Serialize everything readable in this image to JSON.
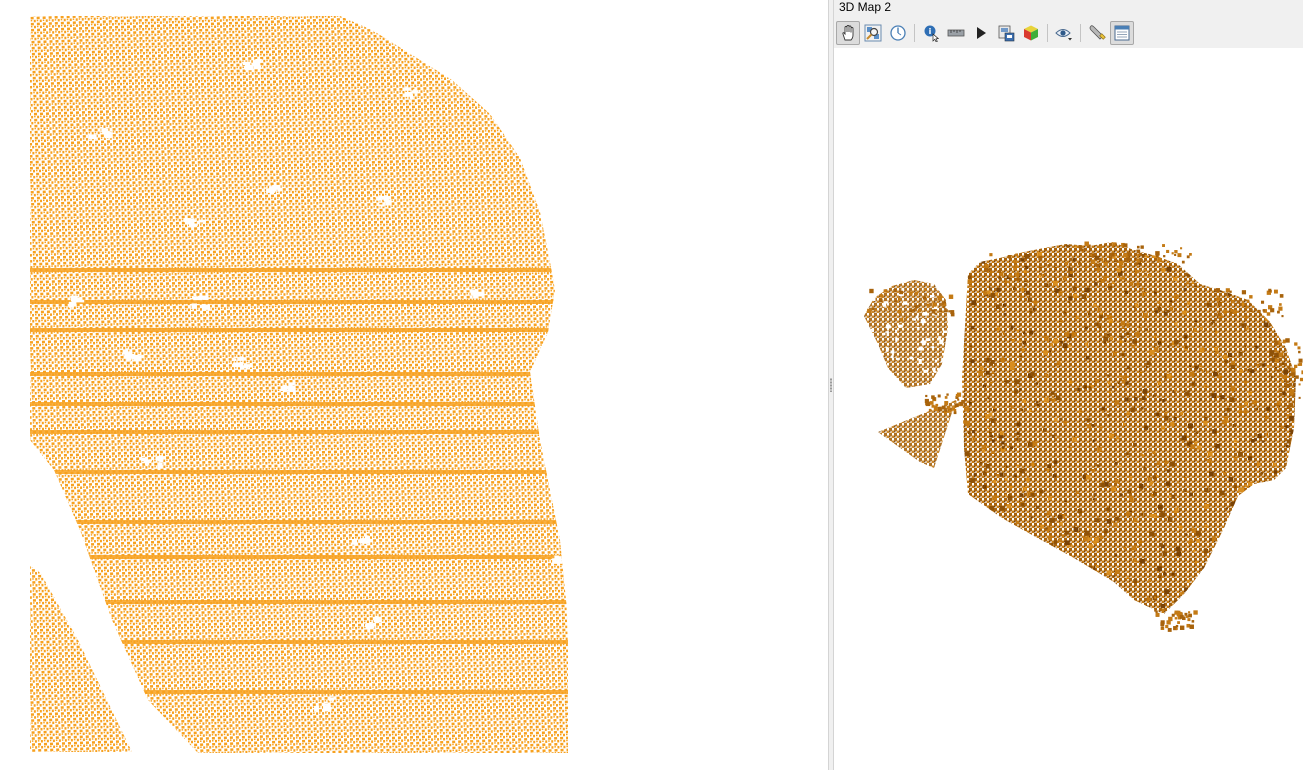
{
  "dock": {
    "title": "3D Map 2"
  },
  "toolbar": {
    "buttons": [
      {
        "name": "camera-control-button",
        "icon": "hand-pan-icon",
        "active": true
      },
      {
        "name": "zoom-full-button",
        "icon": "zoom-full-icon",
        "active": false
      },
      {
        "name": "reset-rotation-button",
        "icon": "compass-icon",
        "active": false
      },
      {
        "name": "identify-button",
        "icon": "identify-icon",
        "active": false
      },
      {
        "name": "measure-button",
        "icon": "measure-ruler-icon",
        "active": false
      },
      {
        "name": "animation-button",
        "icon": "play-icon",
        "active": false
      },
      {
        "name": "save-image-button",
        "icon": "save-image-icon",
        "active": false
      },
      {
        "name": "export-scene-button",
        "icon": "export-3d-icon",
        "active": false
      },
      {
        "name": "camera-view-button",
        "icon": "eye-icon",
        "active": false
      },
      {
        "name": "configure-button",
        "icon": "wrench-icon",
        "active": false
      },
      {
        "name": "dock-undock-button",
        "icon": "window-icon",
        "active": false
      }
    ]
  },
  "colors": {
    "point_2d": "#f7a11f",
    "point_3d": "#a8630c",
    "point_3d_light": "#c47a14",
    "point_3d_dark": "#7a4306",
    "panel_bg": "#f0f0f0"
  }
}
